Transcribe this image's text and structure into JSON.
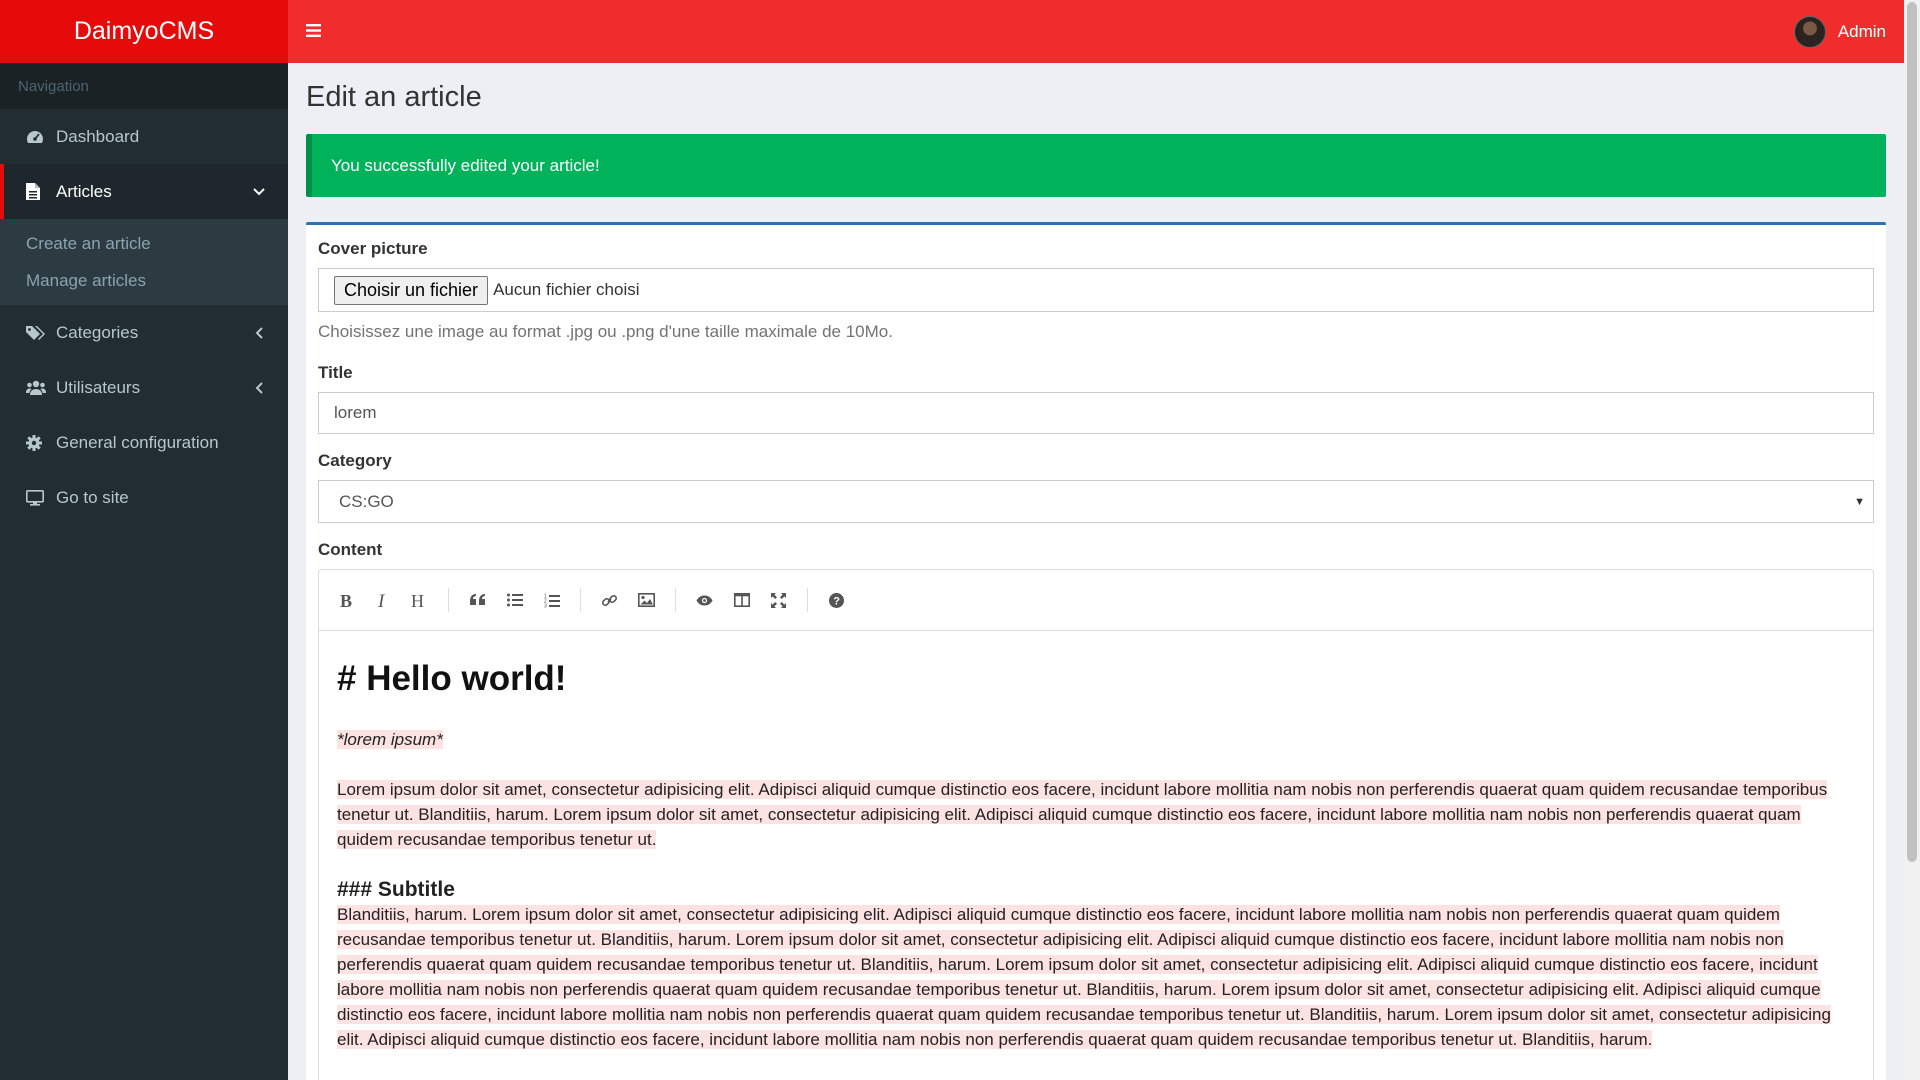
{
  "brand": {
    "name": "DaimyoCMS",
    "accent": "#e60b0b",
    "topbar": "#f02c2c"
  },
  "sidebar": {
    "header": "Navigation",
    "items": [
      {
        "label": "Dashboard",
        "icon": "dashboard-icon"
      },
      {
        "label": "Articles",
        "icon": "file-icon",
        "active": true,
        "expanded": true,
        "children": [
          {
            "label": "Create an article"
          },
          {
            "label": "Manage articles"
          }
        ]
      },
      {
        "label": "Categories",
        "icon": "tags-icon"
      },
      {
        "label": "Utilisateurs",
        "icon": "users-icon"
      },
      {
        "label": "General configuration",
        "icon": "gear-icon"
      },
      {
        "label": "Go to site",
        "icon": "desktop-icon"
      }
    ]
  },
  "topbar": {
    "user_name": "Admin"
  },
  "page": {
    "title": "Edit an article",
    "alert": {
      "text": "You successfully edited your article!",
      "color": "#00b25a"
    }
  },
  "form": {
    "cover": {
      "label": "Cover picture",
      "button": "Choisir un fichier",
      "status": "Aucun fichier choisi",
      "help": "Choisissez une image au format .jpg ou .png d'une taille maximale de 10Mo."
    },
    "title": {
      "label": "Title",
      "value": "lorem"
    },
    "category": {
      "label": "Category",
      "value": "CS:GO"
    },
    "content": {
      "label": "Content",
      "toolbar": [
        "bold-icon",
        "italic-icon",
        "heading-icon",
        "quote-icon",
        "unordered-list-icon",
        "ordered-list-icon",
        "link-icon",
        "image-icon",
        "preview-icon",
        "side-by-side-icon",
        "fullscreen-icon",
        "help-icon"
      ],
      "heading": "# Hello world!",
      "emphasis": "*lorem ipsum*",
      "paragraph1": "Lorem ipsum dolor sit amet, consectetur adipisicing elit. Adipisci aliquid cumque distinctio eos facere, incidunt labore mollitia nam nobis non perferendis quaerat quam quidem recusandae temporibus tenetur ut. Blanditiis, harum. Lorem ipsum dolor sit amet, consectetur adipisicing elit. Adipisci aliquid cumque distinctio eos facere, incidunt labore mollitia nam nobis non perferendis quaerat quam quidem recusandae temporibus tenetur ut.",
      "subheading": "### Subtitle",
      "paragraph2": "Blanditiis, harum. Lorem ipsum dolor sit amet, consectetur adipisicing elit. Adipisci aliquid cumque distinctio eos facere, incidunt labore mollitia nam nobis non perferendis quaerat quam quidem recusandae temporibus tenetur ut. Blanditiis, harum. Lorem ipsum dolor sit amet, consectetur adipisicing elit. Adipisci aliquid cumque distinctio eos facere, incidunt labore mollitia nam nobis non perferendis quaerat quam quidem recusandae temporibus tenetur ut. Blanditiis, harum. Lorem ipsum dolor sit amet, consectetur adipisicing elit. Adipisci aliquid cumque distinctio eos facere, incidunt labore mollitia nam nobis non perferendis quaerat quam quidem recusandae temporibus tenetur ut. Blanditiis, harum. Lorem ipsum dolor sit amet, consectetur adipisicing elit. Adipisci aliquid cumque distinctio eos facere, incidunt labore mollitia nam nobis non perferendis quaerat quam quidem recusandae temporibus tenetur ut. Blanditiis, harum. Lorem ipsum dolor sit amet, consectetur adipisicing elit. Adipisci aliquid cumque distinctio eos facere, incidunt labore mollitia nam nobis non perferendis quaerat quam quidem recusandae temporibus tenetur ut. Blanditiis, harum."
    }
  }
}
